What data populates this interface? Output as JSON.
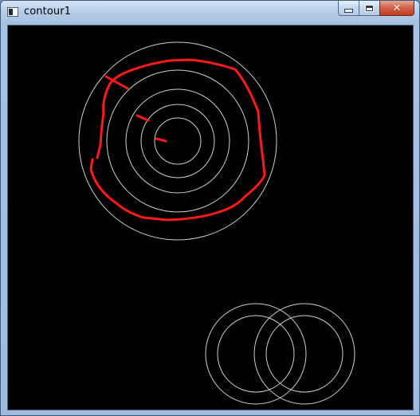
{
  "window": {
    "title": "contour1",
    "app_icon": "opencv-window-icon",
    "caption_buttons": [
      {
        "name": "minimize",
        "icon": "minimize-icon"
      },
      {
        "name": "maximize",
        "icon": "maximize-icon"
      },
      {
        "name": "close",
        "icon": "close-icon"
      }
    ]
  },
  "canvas": {
    "background": "#000000",
    "ring_color": "#d0d0d0",
    "contour_color": "#ff1a1a",
    "shapes": {
      "concentric_rings": 5,
      "interlocking_rings": 2
    }
  }
}
